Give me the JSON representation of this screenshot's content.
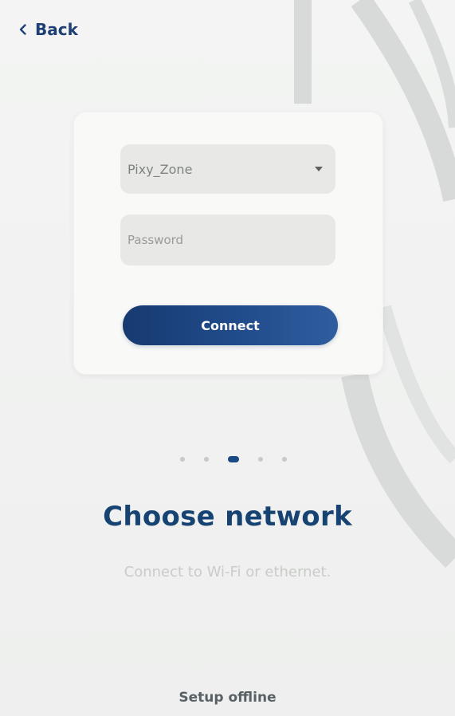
{
  "back": {
    "label": "Back"
  },
  "network": {
    "selected": "Pixy_Zone"
  },
  "password": {
    "placeholder": "Password",
    "value": ""
  },
  "connect": {
    "label": "Connect"
  },
  "pagination": {
    "total": 5,
    "active_index": 2
  },
  "title": "Choose network",
  "subtitle": "Connect to Wi-Fi or ethernet.",
  "offline": {
    "label": "Setup offline"
  },
  "colors": {
    "accent": "#1b467f",
    "button_start": "#173a70",
    "button_end": "#2f5d9e",
    "title": "#174372",
    "subtitle": "#c9ccc8"
  },
  "icons": {
    "back": "chevron-left-icon",
    "select": "caret-down-icon"
  }
}
